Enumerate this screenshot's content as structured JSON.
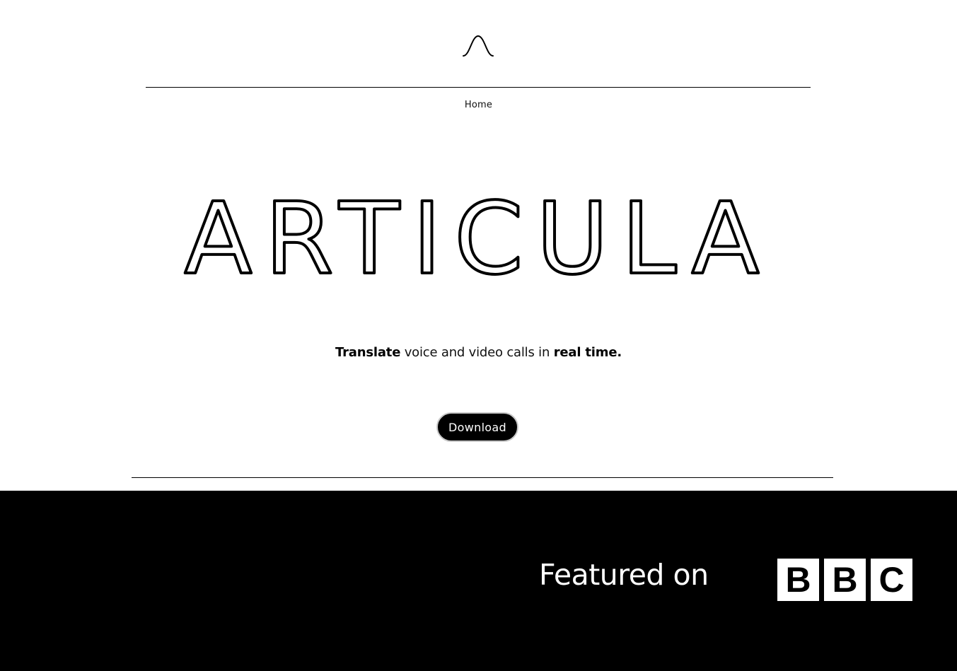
{
  "header": {
    "logo_icon": "bell-curve-icon",
    "nav": {
      "items": [
        {
          "label": "Home"
        }
      ]
    }
  },
  "hero": {
    "title": "ARTICULA",
    "tagline": {
      "part1_bold": "Translate",
      "part2": " voice and video calls in ",
      "part3_bold": "real time."
    },
    "download_label": "Download"
  },
  "footer": {
    "featured_text": "Featured on",
    "bbc_letters": [
      "B",
      "B",
      "C"
    ]
  },
  "colors": {
    "background": "#ffffff",
    "footer_background": "#000000",
    "button_background": "#000000",
    "button_border": "#c8c8c8",
    "text": "#000000"
  }
}
